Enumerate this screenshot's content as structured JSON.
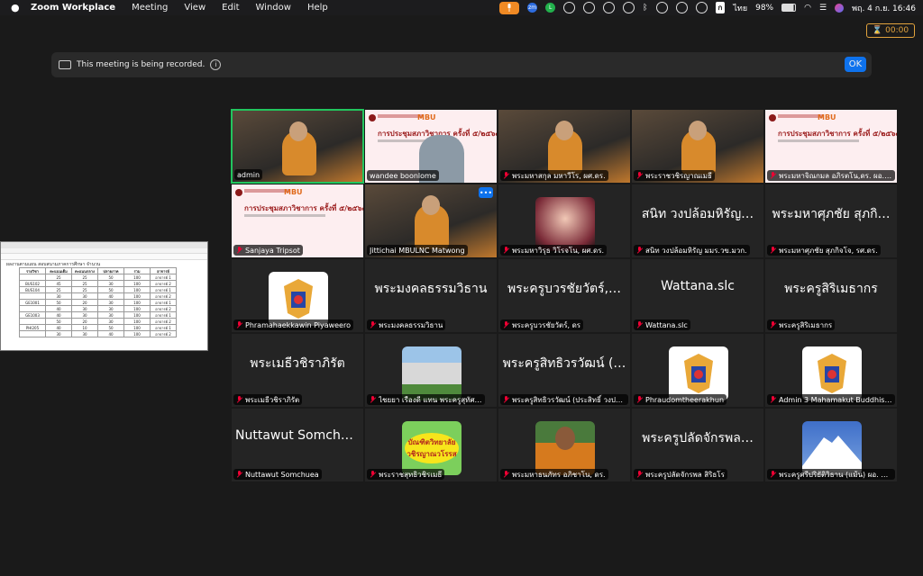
{
  "menubar": {
    "app": "Zoom Workplace",
    "menus": [
      "Meeting",
      "View",
      "Edit",
      "Window",
      "Help"
    ],
    "lang": "ก",
    "lang_label": "ไทย",
    "battery": "98%",
    "clock": "พฤ. 4 ก.ย.  16:46"
  },
  "timer": "00:00",
  "banner": {
    "text": "This meeting is being recorded.",
    "ok": "OK"
  },
  "participants": [
    {
      "name": "admin",
      "kind": "video",
      "active": true
    },
    {
      "name": "wandee boonlome",
      "kind": "slide-video"
    },
    {
      "name": "พระมหาสกุล มหาวีโร, ผศ.ดร.",
      "kind": "video",
      "muted": true
    },
    {
      "name": "พระราชวชิรญาณเมธี",
      "kind": "video",
      "muted": true
    },
    {
      "name": "พระมหาจิณกมล อภิรตโน,ดร. ผอ.ส…",
      "kind": "slide",
      "muted": true
    },
    {
      "name": "Sanjaya Tripsot",
      "kind": "slide",
      "muted": true
    },
    {
      "name": "Jittichai MBULNC Matwong",
      "kind": "video",
      "more": true
    },
    {
      "name": "พระมหาวิรุธ วิโรจโน, ผศ.ดร.",
      "kind": "avatar",
      "muted": true
    },
    {
      "name": "สนิท  วงปล้อมหิรัญ มมร.วข.มวก.",
      "display": "สนิท  วงปล้อมหิรัญ…",
      "kind": "name",
      "muted": true
    },
    {
      "name": "พระมหาศุภชัย สุภกิจโจ, รศ.ดร.",
      "display": "พระมหาศุภชัย สุภกิ…",
      "kind": "name",
      "muted": true
    },
    {
      "name": "Phramahaekkawin Piyaweero",
      "kind": "emblem",
      "muted": true
    },
    {
      "name": "พระมงคลธรรมวิธาน",
      "display": "พระมงคลธรรมวิธาน",
      "kind": "name",
      "muted": true
    },
    {
      "name": "พระครูบวรชัยวัตร์, ดร",
      "display": "พระครูบวรชัยวัตร์,…",
      "kind": "name",
      "muted": true
    },
    {
      "name": "Wattana.slc",
      "display": "Wattana.slc",
      "kind": "name",
      "muted": true
    },
    {
      "name": "พระครูสิริเมธากร",
      "display": "พระครูสิริเมธากร",
      "kind": "name",
      "muted": true
    },
    {
      "name": "พระเมธีวชิราภิรัต",
      "display": "พระเมธีวชิราภิรัต",
      "kind": "name",
      "muted": true
    },
    {
      "name": "ไชยยา  เรืองดี  แทน  พระครูสุทัศ…",
      "kind": "building",
      "muted": true
    },
    {
      "name": "พระครูสิทธิวรวัฒน์ (ประสิทธิ์ วงประ…",
      "display": "พระครูสิทธิวรวัฒน์ (…",
      "kind": "name",
      "muted": true
    },
    {
      "name": "Phraudomtheerakhun",
      "kind": "emblem",
      "muted": true
    },
    {
      "name": "Admin 3 Mahamakut Buddhist Un…",
      "kind": "emblem",
      "muted": true
    },
    {
      "name": "Nuttawut Somchuea",
      "display": "Nuttawut Somchuea",
      "kind": "name",
      "muted": true
    },
    {
      "name": "พระราชสุทธิวชิรเมธี",
      "kind": "yellow",
      "avatar_text": "บัณฑิตวิทยาลัย วชิรญาณวโรรส",
      "muted": true
    },
    {
      "name": "พระมหาธนภัทร อภิชาโน, ดร.",
      "kind": "monk",
      "muted": true
    },
    {
      "name": "พระครูปลัดจักรพล สิริธโร",
      "display": "พระครูปลัดจักรพล…",
      "kind": "name",
      "muted": true
    },
    {
      "name": "พระครูศรีปริยัติวิธาน (แม้น) ผอ. ศู…",
      "kind": "mountain",
      "muted": true
    }
  ],
  "slide": {
    "brand": "MBU",
    "title": "การประชุมสภาวิชาการ ครั้งที่ ๕/๒๕๖๘"
  },
  "spreadsheet": {
    "caption": "ผลงานตามแผน สอบสนามภาคการศึกษา จำนวน",
    "headers": [
      "รายวิชา",
      "คะแนนเต็ม",
      "คะแนนกลาง",
      "ปลายภาค",
      "รวม",
      "อาจารย์"
    ],
    "rows": [
      [
        "",
        "25",
        "25",
        "50",
        "100",
        "อาจารย์ 1"
      ],
      [
        "BUS102",
        "45",
        "25",
        "30",
        "100",
        "อาจารย์ 2"
      ],
      [
        "BUS104",
        "25",
        "25",
        "50",
        "100",
        "อาจารย์ 1"
      ],
      [
        "",
        "30",
        "30",
        "40",
        "100",
        "อาจารย์ 2"
      ],
      [
        "GE1001",
        "50",
        "20",
        "30",
        "100",
        "อาจารย์ 1"
      ],
      [
        "",
        "40",
        "30",
        "30",
        "100",
        "อาจารย์ 2"
      ],
      [
        "GE1003",
        "40",
        "30",
        "30",
        "100",
        "อาจารย์ 1"
      ],
      [
        "",
        "50",
        "20",
        "30",
        "100",
        "อาจารย์ 2"
      ],
      [
        "PHI205",
        "40",
        "10",
        "50",
        "100",
        "อาจารย์ 1"
      ],
      [
        "",
        "30",
        "30",
        "40",
        "100",
        "อาจารย์ 2"
      ]
    ]
  }
}
